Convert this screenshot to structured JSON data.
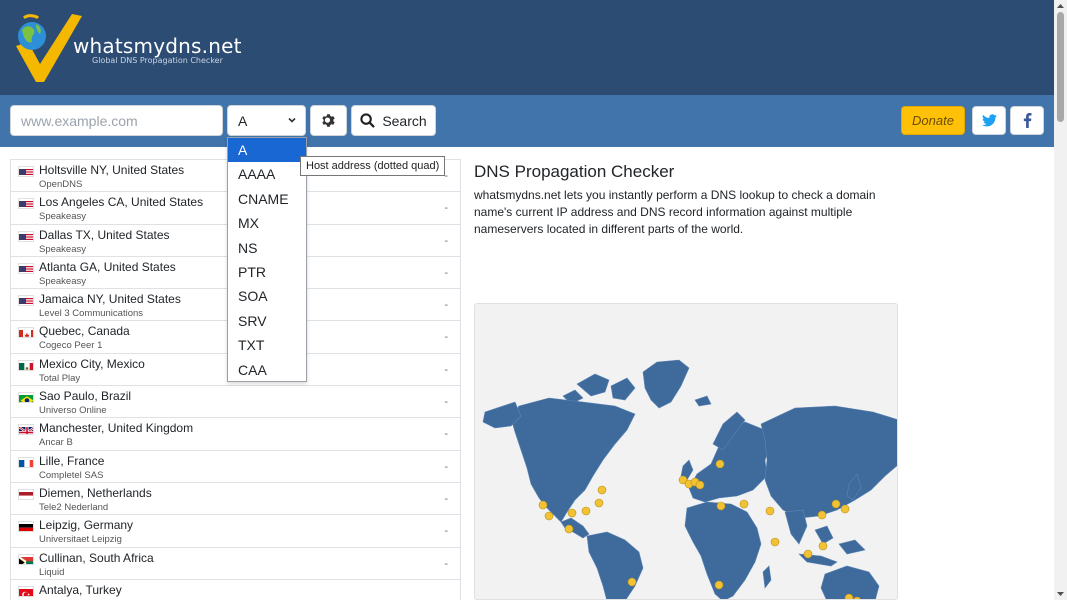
{
  "brand": {
    "name": "whatsmydns.net",
    "tagline": "Global DNS Propagation Checker"
  },
  "toolbar": {
    "search_placeholder": "www.example.com",
    "record_type": "A",
    "search_label": "Search",
    "donate_label": "Donate"
  },
  "record_dropdown": {
    "options": [
      "A",
      "AAAA",
      "CNAME",
      "MX",
      "NS",
      "PTR",
      "SOA",
      "SRV",
      "TXT",
      "CAA"
    ],
    "selected": "A",
    "tooltip": "Host address (dotted quad)"
  },
  "servers": [
    {
      "location": "Holtsville NY, United States",
      "provider": "OpenDNS",
      "result": "-",
      "flag": "us"
    },
    {
      "location": "Los Angeles CA, United States",
      "provider": "Speakeasy",
      "result": "-",
      "flag": "us"
    },
    {
      "location": "Dallas TX, United States",
      "provider": "Speakeasy",
      "result": "-",
      "flag": "us"
    },
    {
      "location": "Atlanta GA, United States",
      "provider": "Speakeasy",
      "result": "-",
      "flag": "us"
    },
    {
      "location": "Jamaica NY, United States",
      "provider": "Level 3 Communications",
      "result": "-",
      "flag": "us"
    },
    {
      "location": "Quebec, Canada",
      "provider": "Cogeco Peer 1",
      "result": "-",
      "flag": "ca"
    },
    {
      "location": "Mexico City, Mexico",
      "provider": "Total Play",
      "result": "-",
      "flag": "mx"
    },
    {
      "location": "Sao Paulo, Brazil",
      "provider": "Universo Online",
      "result": "-",
      "flag": "br"
    },
    {
      "location": "Manchester, United Kingdom",
      "provider": "Ancar B",
      "result": "-",
      "flag": "gb"
    },
    {
      "location": "Lille, France",
      "provider": "Completel SAS",
      "result": "-",
      "flag": "fr"
    },
    {
      "location": "Diemen, Netherlands",
      "provider": "Tele2 Nederland",
      "result": "-",
      "flag": "nl"
    },
    {
      "location": "Leipzig, Germany",
      "provider": "Universitaet Leipzig",
      "result": "-",
      "flag": "de"
    },
    {
      "location": "Cullinan, South Africa",
      "provider": "Liquid",
      "result": "-",
      "flag": "za"
    },
    {
      "location": "Antalya, Turkey",
      "provider": "",
      "result": "",
      "flag": "tr"
    }
  ],
  "main": {
    "title": "DNS Propagation Checker",
    "description": "whatsmydns.net lets you instantly perform a DNS lookup to check a domain name's current IP address and DNS record information against multiple nameservers located in different parts of the world."
  },
  "colors": {
    "header": "#2c4c74",
    "toolbar": "#4074ab",
    "map_land": "#3f6a9c",
    "map_marker": "#f0c234",
    "donate": "#ffc107",
    "selected_option": "#1967d2"
  },
  "icons": {
    "settings": "gear-icon",
    "search": "magnifier-icon",
    "twitter": "twitter-icon",
    "facebook": "facebook-icon"
  }
}
